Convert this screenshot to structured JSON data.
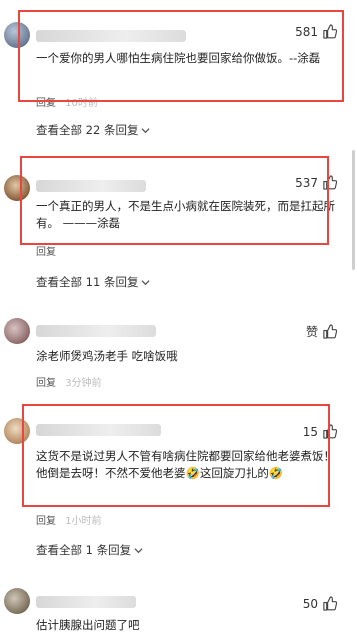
{
  "comments": [
    {
      "likes": "581",
      "text": "一个爱你的男人哪怕生病住院也要回家给你做饭。--涂磊",
      "reply": "回复",
      "time": "10时前",
      "view_all": "查看全部 22 条回复"
    },
    {
      "likes": "537",
      "text": "一个真正的男人，不是生点小病就在医院装死，而是扛起所有。 ———涂磊",
      "reply": "回复",
      "time": "",
      "view_all": "查看全部 11 条回复"
    },
    {
      "likes": "赞",
      "text": "涂老师煲鸡汤老手 吃啥饭哦",
      "reply": "回复",
      "time": "3分钟前",
      "view_all": ""
    },
    {
      "likes": "15",
      "text": "这货不是说过男人不管有啥病住院都要回家给他老婆煮饭！他倒是去呀！不然不爱他老婆🤣这回旋刀扎的🤣",
      "reply": "回复",
      "time": "1小时前",
      "view_all": "查看全部 1 条回复"
    },
    {
      "likes": "50",
      "text": "估计胰腺出问题了吧",
      "reply": "",
      "time": "",
      "view_all": ""
    }
  ],
  "colors": {
    "highlight": "#e8463e",
    "text": "#222222",
    "meta": "#999999"
  },
  "icons": {
    "like": "thumbs-up-icon",
    "expand": "chevron-down-icon"
  }
}
